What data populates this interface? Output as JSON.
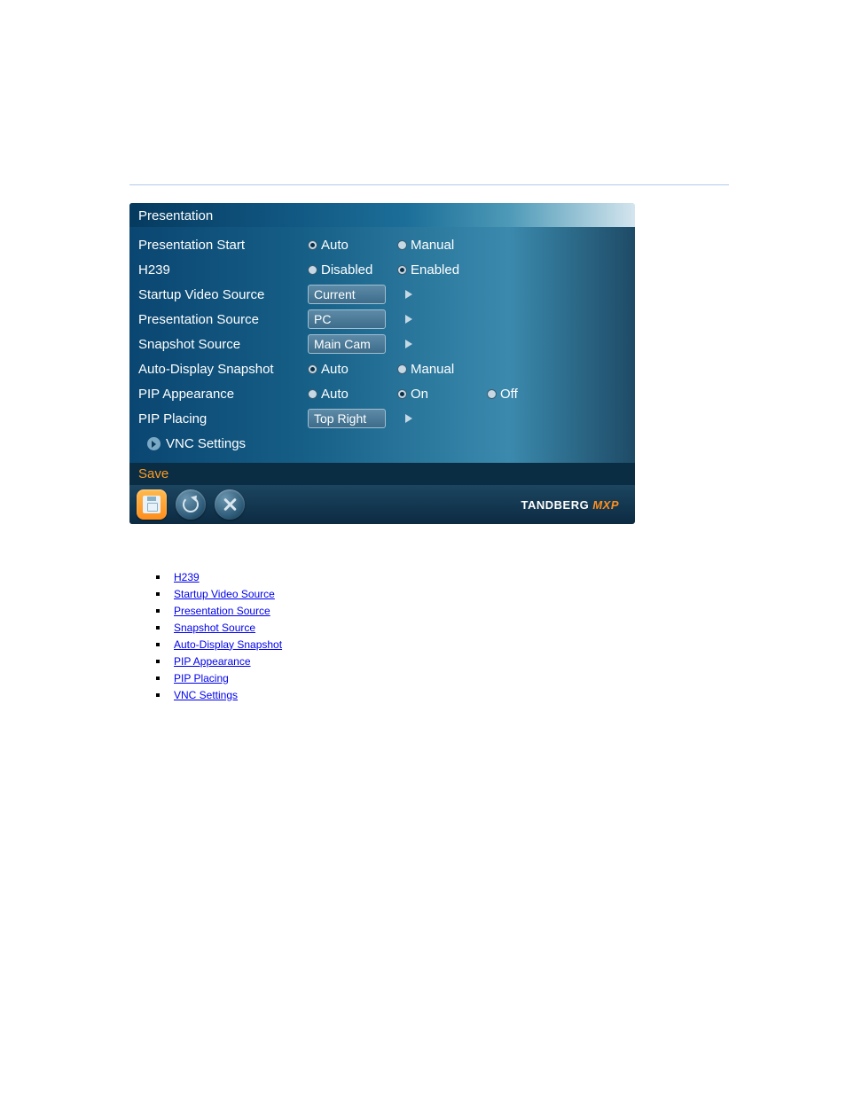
{
  "panel": {
    "title": "Presentation",
    "rows": [
      {
        "label": "Presentation Start",
        "radios": [
          "Auto",
          "Manual"
        ],
        "selectedIndex": 0
      },
      {
        "label": "H239",
        "radios": [
          "Disabled",
          "Enabled"
        ],
        "selectedIndex": 1
      },
      {
        "label": "Startup Video Source",
        "select": "Current"
      },
      {
        "label": "Presentation Source",
        "select": "PC"
      },
      {
        "label": "Snapshot Source",
        "select": "Main Cam"
      },
      {
        "label": "Auto-Display Snapshot",
        "radios": [
          "Auto",
          "Manual"
        ],
        "selectedIndex": 0
      },
      {
        "label": "PIP Appearance",
        "radios": [
          "Auto",
          "On",
          "Off"
        ],
        "selectedIndex": 1
      },
      {
        "label": "PIP Placing",
        "select": "Top Right"
      }
    ],
    "submenu": "VNC Settings",
    "saveLabel": "Save",
    "brand1": "TANDBERG",
    "brand2": "MXP"
  },
  "links": [
    "H239",
    "Startup Video Source",
    "Presentation Source",
    "Snapshot Source",
    "Auto-Display Snapshot",
    "PIP Appearance",
    "PIP Placing",
    "VNC Settings"
  ]
}
